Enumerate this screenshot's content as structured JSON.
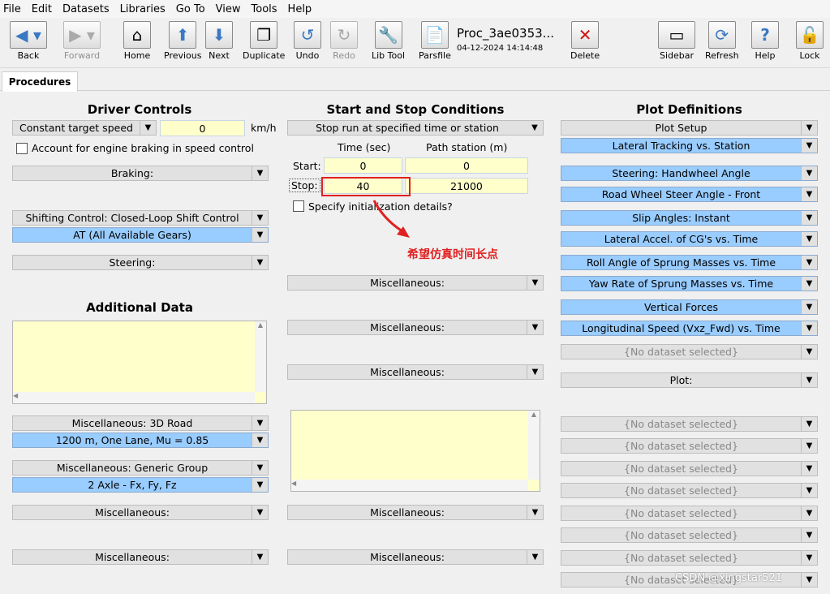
{
  "menu": [
    "File",
    "Edit",
    "Datasets",
    "Libraries",
    "Go To",
    "View",
    "Tools",
    "Help"
  ],
  "toolbar": {
    "back": "Back",
    "forward": "Forward",
    "home": "Home",
    "previous": "Previous",
    "next": "Next",
    "duplicate": "Duplicate",
    "undo": "Undo",
    "redo": "Redo",
    "libtool": "Lib Tool",
    "parsfile": "Parsfile",
    "delete": "Delete",
    "sidebar": "Sidebar",
    "refresh": "Refresh",
    "help": "Help",
    "lock": "Lock"
  },
  "procedure": {
    "title": "Proc_3ae0353...",
    "date": "04-12-2024 14:14:48"
  },
  "tabs": [
    "Procedures"
  ],
  "driver": {
    "heading": "Driver Controls",
    "speed_mode": "Constant target speed",
    "speed_value": "0",
    "speed_unit": "km/h",
    "engine_braking_label": "Account for engine braking in speed control",
    "braking": "Braking:",
    "shifting": "Shifting Control: Closed-Loop Shift Control",
    "gears": "AT (All Available Gears)",
    "steering": "Steering:"
  },
  "additional": {
    "heading": "Additional Data",
    "misc3d": "Miscellaneous: 3D Road",
    "road": "1200 m, One Lane, Mu = 0.85",
    "generic": "Miscellaneous: Generic Group",
    "axle": "2 Axle - Fx, Fy, Fz",
    "misc_a": "Miscellaneous:",
    "misc_b": "Miscellaneous:"
  },
  "startstop": {
    "heading": "Start and Stop Conditions",
    "mode": "Stop run at specified time or station",
    "time_header": "Time (sec)",
    "path_header": "Path station (m)",
    "start_label": "Start:",
    "start_time": "0",
    "start_path": "0",
    "stop_label": "Stop:",
    "stop_time": "40",
    "stop_path": "21000",
    "init_label": "Specify initialization details?",
    "misc": [
      "Miscellaneous:",
      "Miscellaneous:",
      "Miscellaneous:",
      "Miscellaneous:",
      "Miscellaneous:"
    ]
  },
  "annotation": "希望仿真时间长点",
  "plot": {
    "heading": "Plot Definitions",
    "setup": "Plot Setup",
    "lateral": "Lateral Tracking vs. Station",
    "items": [
      "Steering: Handwheel Angle",
      "Road Wheel Steer Angle - Front",
      "Slip Angles: Instant",
      "Lateral Accel. of CG's vs. Time",
      "Roll Angle of Sprung Masses vs. Time",
      "Yaw Rate of Sprung Masses vs. Time",
      "Vertical Forces",
      "Longitudinal Speed (Vxz_Fwd) vs. Time"
    ],
    "none": "{No dataset selected}",
    "plot_label": "Plot:"
  },
  "watermark": "CSDN @xingstar521"
}
